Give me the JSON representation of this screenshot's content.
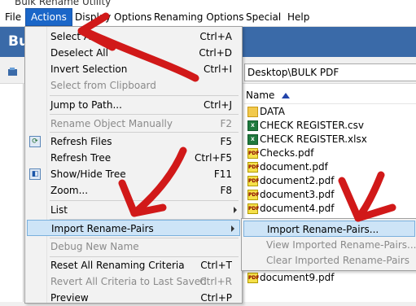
{
  "window": {
    "title": "Bulk Rename Utility"
  },
  "menubar": [
    "File",
    "Actions",
    "Display Options",
    "Renaming Options",
    "Special",
    "Help"
  ],
  "app_banner": "Bulk",
  "toolbar": {
    "path": "Desktop\\BULK PDF"
  },
  "file_list": {
    "header": "Name",
    "rows": [
      {
        "name": "DATA",
        "type": "folder"
      },
      {
        "name": "CHECK REGISTER.csv",
        "type": "excel"
      },
      {
        "name": "CHECK REGISTER.xlsx",
        "type": "excel"
      },
      {
        "name": "Checks.pdf",
        "type": "pdf"
      },
      {
        "name": "document.pdf",
        "type": "pdf"
      },
      {
        "name": "document2.pdf",
        "type": "pdf"
      },
      {
        "name": "document3.pdf",
        "type": "pdf"
      },
      {
        "name": "document4.pdf",
        "type": "pdf"
      },
      {
        "name": "document9.pdf",
        "type": "pdf"
      }
    ]
  },
  "actions_menu": {
    "items": [
      {
        "label": "Select A",
        "shortcut": "Ctrl+A"
      },
      {
        "label": "Deselect All",
        "shortcut": "Ctrl+D"
      },
      {
        "label": "Invert Selection",
        "shortcut": "Ctrl+I"
      },
      {
        "label": "Select from Clipboard",
        "shortcut": ""
      },
      {
        "label": "Jump to Path...",
        "shortcut": "Ctrl+J"
      },
      {
        "label": "Rename Object Manually",
        "shortcut": "F2"
      },
      {
        "label": "Refresh Files",
        "shortcut": "F5"
      },
      {
        "label": "Refresh Tree",
        "shortcut": "Ctrl+F5"
      },
      {
        "label": "Show/Hide Tree",
        "shortcut": "F11"
      },
      {
        "label": "Zoom...",
        "shortcut": "F8"
      },
      {
        "label": "List",
        "shortcut": ""
      },
      {
        "label": "Import Rename-Pairs",
        "shortcut": ""
      },
      {
        "label": "Debug New Name",
        "shortcut": ""
      },
      {
        "label": "Reset All Renaming Criteria",
        "shortcut": "Ctrl+T"
      },
      {
        "label": "Revert All Criteria to Last Saved",
        "shortcut": "Ctrl+R"
      },
      {
        "label": "Preview",
        "shortcut": "Ctrl+P"
      }
    ]
  },
  "submenu": {
    "items": [
      {
        "label": "Import Rename-Pairs..."
      },
      {
        "label": "View Imported Rename-Pairs..."
      },
      {
        "label": "Clear Imported Rename-Pairs"
      }
    ]
  },
  "colors": {
    "menu_highlight": "#cde4f7",
    "active_menu": "#1a66c8",
    "banner": "#3a6aa8",
    "annotation": "#d11919"
  }
}
